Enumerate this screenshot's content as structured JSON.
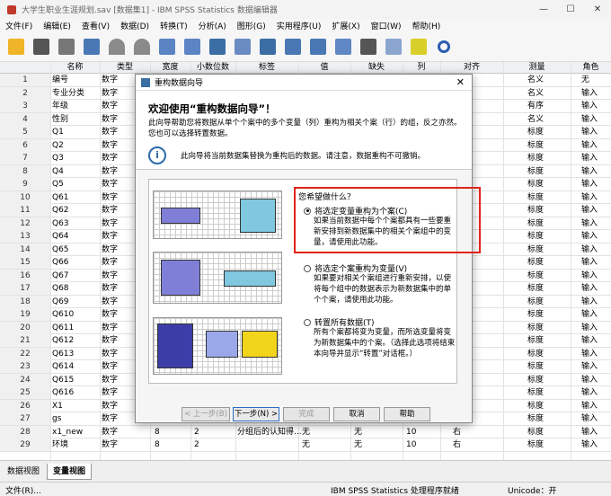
{
  "window": {
    "title": "大学生职业生涯规划.sav [数据集1] - IBM SPSS Statistics 数据编辑器",
    "buttons": [
      "—",
      "☐",
      "✕"
    ]
  },
  "menu": [
    "文件(F)",
    "编辑(E)",
    "查看(V)",
    "数据(D)",
    "转换(T)",
    "分析(A)",
    "图形(G)",
    "实用程序(U)",
    "扩展(X)",
    "窗口(W)",
    "帮助(H)"
  ],
  "columns": [
    "名称",
    "类型",
    "宽度",
    "小数位数",
    "标签",
    "值",
    "缺失",
    "列",
    "对齐",
    "测量",
    "角色"
  ],
  "rows": [
    {
      "n": "1",
      "name": "编号",
      "type": "数字",
      "measure": "名义",
      "role": "无"
    },
    {
      "n": "2",
      "name": "专业分类",
      "type": "数字",
      "measure": "名义",
      "role": "输入"
    },
    {
      "n": "3",
      "name": "年级",
      "type": "数字",
      "measure": "有序",
      "role": "输入"
    },
    {
      "n": "4",
      "name": "性别",
      "type": "数字",
      "measure": "名义",
      "role": "输入"
    },
    {
      "n": "5",
      "name": "Q1",
      "type": "数字",
      "measure": "标度",
      "role": "输入"
    },
    {
      "n": "6",
      "name": "Q2",
      "type": "数字",
      "measure": "标度",
      "role": "输入"
    },
    {
      "n": "7",
      "name": "Q3",
      "type": "数字",
      "measure": "标度",
      "role": "输入"
    },
    {
      "n": "8",
      "name": "Q4",
      "type": "数字",
      "measure": "标度",
      "role": "输入"
    },
    {
      "n": "9",
      "name": "Q5",
      "type": "数字",
      "measure": "标度",
      "role": "输入"
    },
    {
      "n": "10",
      "name": "Q61",
      "type": "数字",
      "measure": "标度",
      "role": "输入"
    },
    {
      "n": "11",
      "name": "Q62",
      "type": "数字",
      "measure": "标度",
      "role": "输入"
    },
    {
      "n": "12",
      "name": "Q63",
      "type": "数字",
      "measure": "标度",
      "role": "输入"
    },
    {
      "n": "13",
      "name": "Q64",
      "type": "数字",
      "measure": "标度",
      "role": "输入"
    },
    {
      "n": "14",
      "name": "Q65",
      "type": "数字",
      "measure": "标度",
      "role": "输入"
    },
    {
      "n": "15",
      "name": "Q66",
      "type": "数字",
      "measure": "标度",
      "role": "输入"
    },
    {
      "n": "16",
      "name": "Q67",
      "type": "数字",
      "measure": "标度",
      "role": "输入"
    },
    {
      "n": "17",
      "name": "Q68",
      "type": "数字",
      "measure": "标度",
      "role": "输入"
    },
    {
      "n": "18",
      "name": "Q69",
      "type": "数字",
      "measure": "标度",
      "role": "输入"
    },
    {
      "n": "19",
      "name": "Q610",
      "type": "数字",
      "measure": "标度",
      "role": "输入"
    },
    {
      "n": "20",
      "name": "Q611",
      "type": "数字",
      "measure": "标度",
      "role": "输入"
    },
    {
      "n": "21",
      "name": "Q612",
      "type": "数字",
      "measure": "标度",
      "role": "输入"
    },
    {
      "n": "22",
      "name": "Q613",
      "type": "数字",
      "measure": "标度",
      "role": "输入"
    },
    {
      "n": "23",
      "name": "Q614",
      "type": "数字",
      "measure": "标度",
      "role": "输入"
    },
    {
      "n": "24",
      "name": "Q615",
      "type": "数字",
      "measure": "标度",
      "role": "输入"
    },
    {
      "n": "25",
      "name": "Q616",
      "type": "数字",
      "measure": "标度",
      "role": "输入"
    },
    {
      "n": "26",
      "name": "X1",
      "type": "数字",
      "measure": "标度",
      "role": "输入"
    },
    {
      "n": "27",
      "name": "gs",
      "type": "数字",
      "measure": "标度",
      "role": "输入"
    },
    {
      "n": "28",
      "name": "x1_new",
      "type": "数字",
      "measure": "标度",
      "role": "输入",
      "width": "8",
      "dec": "2",
      "label": "分组后的认知得...",
      "values": "无",
      "missing": "无",
      "cols": "10",
      "align": "右"
    },
    {
      "n": "29",
      "name": "环境",
      "type": "数字",
      "measure": "标度",
      "role": "输入",
      "width": "8",
      "dec": "2",
      "label": "",
      "values": "无",
      "missing": "无",
      "cols": "10",
      "align": "右"
    }
  ],
  "tabs": {
    "data": "数据视图",
    "variable": "变量视图"
  },
  "status": {
    "menu": "文件(R)...",
    "processor": "IBM SPSS Statistics 处理程序就绪",
    "unicode": "Unicode：开"
  },
  "dialog": {
    "title": "重构数据向导",
    "heading": "欢迎使用“重构数据向导”！",
    "desc": "此向导帮助您将数据从单个个案中的多个变量（列）重构为相关个案（行）的组，反之亦然。您也可以选择转置数据。",
    "note": "此向导将当前数据集替换为重构后的数据。请注意，数据重构不可撤销。",
    "question": "您希望做什么？",
    "options": [
      {
        "label": "将选定变量重构为个案(C)",
        "desc": "如果当前数据中每个个案都具有一些要重新安排到新数据集中的相关个案组中的变量，请使用此功能。",
        "selected": true
      },
      {
        "label": "将选定个案重构为变量(V)",
        "desc": "如果要对相关个案组进行重新安排，以使将每个组中的数据表示为新数据集中的单个个案，请使用此功能。",
        "selected": false
      },
      {
        "label": "转置所有数据(T)",
        "desc": "所有个案都将变为变量，而所选变量将变为新数据集中的个案。（选择此选项将结束本向导并显示“转置”对话框。）",
        "selected": false
      }
    ],
    "buttons": {
      "back": "< 上一步(B)",
      "next": "下一步(N) >",
      "finish": "完成",
      "cancel": "取消",
      "help": "帮助"
    }
  },
  "colors": {
    "highlight": "#e0241a",
    "accent": "#2b6cc4"
  }
}
